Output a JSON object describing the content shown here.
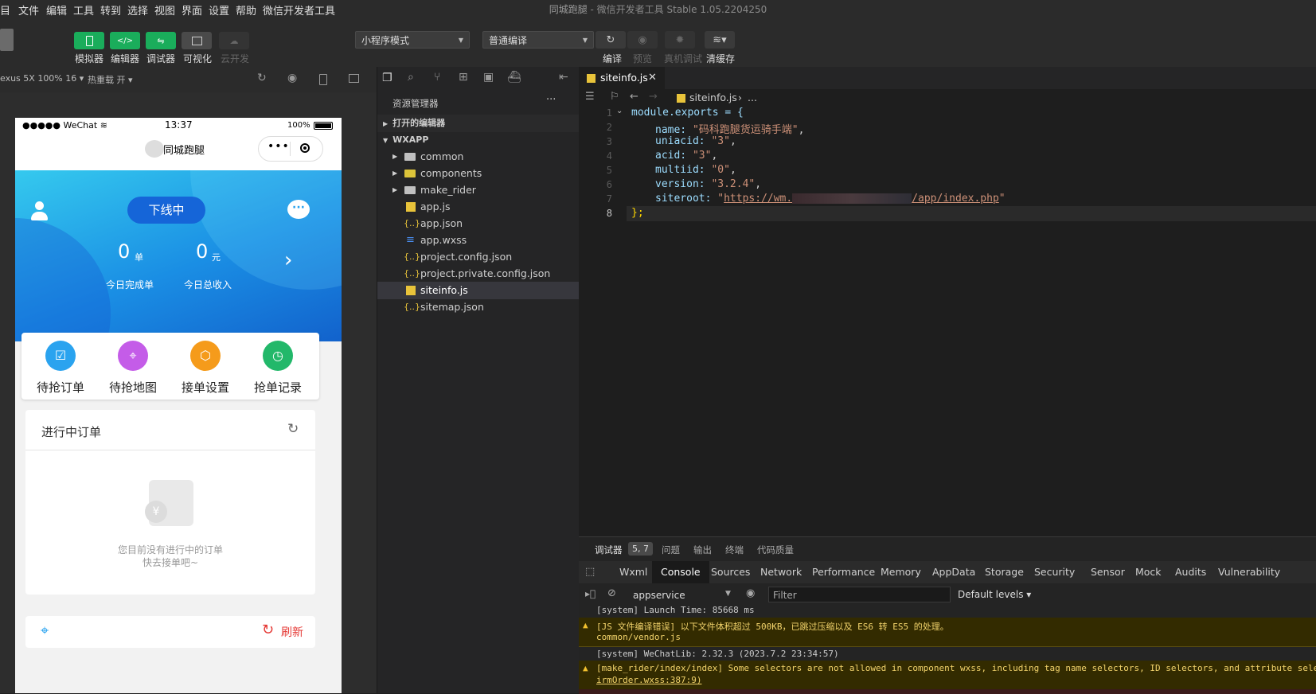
{
  "menubar": {
    "items": [
      "目",
      "文件",
      "编辑",
      "工具",
      "转到",
      "选择",
      "视图",
      "界面",
      "设置",
      "帮助",
      "微信开发者工具"
    ],
    "title_project": "同城跑腿",
    "title_app": " - 微信开发者工具 Stable 1.05.2204250"
  },
  "toolbar": {
    "simulator": "模拟器",
    "editor": "编辑器",
    "debugger": "调试器",
    "visual": "可视化",
    "cloud": "云开发",
    "mode_select": "小程序模式",
    "compile_select": "普通编译",
    "compile": "编译",
    "preview": "预览",
    "real_debug": "真机调试",
    "clear_cache": "清缓存"
  },
  "simbar": {
    "device": "exus 5X 100% 16",
    "hot_reload": "热重载 开"
  },
  "phone": {
    "status_signal": "●●●●● WeChat",
    "status_time": "13:37",
    "status_battery": "100%",
    "nav_title": "同城跑腿",
    "online_button": "下线中",
    "stat1_value": "0",
    "stat1_unit": "单",
    "stat1_label": "今日完成单",
    "stat2_value": "0",
    "stat2_unit": "元",
    "stat2_label": "今日总收入",
    "grid": [
      {
        "label": "待抢订单",
        "color": "#2aa3ef"
      },
      {
        "label": "待抢地图",
        "color": "#c45ce8"
      },
      {
        "label": "接单设置",
        "color": "#f59b1b"
      },
      {
        "label": "抢单记录",
        "color": "#22b86a"
      }
    ],
    "orders_title": "进行中订单",
    "empty_line1": "您目前没有进行中的订单",
    "empty_line2": "快去接单吧~",
    "refresh": "刷新"
  },
  "explorer": {
    "title": "资源管理器",
    "open_editors": "打开的编辑器",
    "root": "WXAPP",
    "items": [
      {
        "name": "common",
        "kind": "folder"
      },
      {
        "name": "components",
        "kind": "folder"
      },
      {
        "name": "make_rider",
        "kind": "folder"
      },
      {
        "name": "app.js",
        "kind": "js"
      },
      {
        "name": "app.json",
        "kind": "json"
      },
      {
        "name": "app.wxss",
        "kind": "wxss"
      },
      {
        "name": "project.config.json",
        "kind": "json"
      },
      {
        "name": "project.private.config.json",
        "kind": "json"
      },
      {
        "name": "siteinfo.js",
        "kind": "js"
      },
      {
        "name": "sitemap.json",
        "kind": "json"
      }
    ]
  },
  "editor": {
    "tab": "siteinfo.js",
    "breadcrumb": "siteinfo.js",
    "breadcrumb_more": "...",
    "line_numbers": [
      "1",
      "2",
      "3",
      "4",
      "5",
      "6",
      "7",
      "8"
    ],
    "code": {
      "l1": "module.exports = {",
      "name_key": "name: ",
      "name_val": "\"码科跑腿货运骑手端\"",
      "uniacid_key": "uniacid: ",
      "uniacid_val": "\"3\"",
      "acid_key": "acid: ",
      "acid_val": "\"3\"",
      "multiid_key": "multiid: ",
      "multiid_val": "\"0\"",
      "version_key": "version: ",
      "version_val": "\"3.2.4\"",
      "siteroot_key": "siteroot: ",
      "siteroot_q": "\"",
      "siteroot_a": "https://wm.",
      "siteroot_b": "/app/index.php",
      "siteroot_q2": "\"",
      "comma": ",",
      "l8": "};"
    }
  },
  "debugger": {
    "tabs": [
      "调试器",
      "问题",
      "输出",
      "终端",
      "代码质量"
    ],
    "badge": "5, 7",
    "console_tabs": [
      "Wxml",
      "Console",
      "Sources",
      "Network",
      "Performance",
      "Memory",
      "AppData",
      "Storage",
      "Security",
      "Sensor",
      "Mock",
      "Audits",
      "Vulnerability"
    ],
    "context": "appservice",
    "filter_placeholder": "Filter",
    "levels": "Default levels",
    "lines": {
      "l1": "[system] Launch Time: 85668 ms",
      "l2": "[JS 文件编译错误] 以下文件体积超过 500KB，已跳过压缩以及 ES6 转 ES5 的处理。",
      "l2b": "common/vendor.js",
      "l3": "[system] WeChatLib: 2.32.3 (2023.7.2 23:34:57)",
      "l4": "[make_rider/index/index] Some selectors are not allowed in component wxss, including tag name selectors, ID selectors, and attribute sele",
      "l4b": "irmOrder.wxss:387:9)"
    }
  }
}
